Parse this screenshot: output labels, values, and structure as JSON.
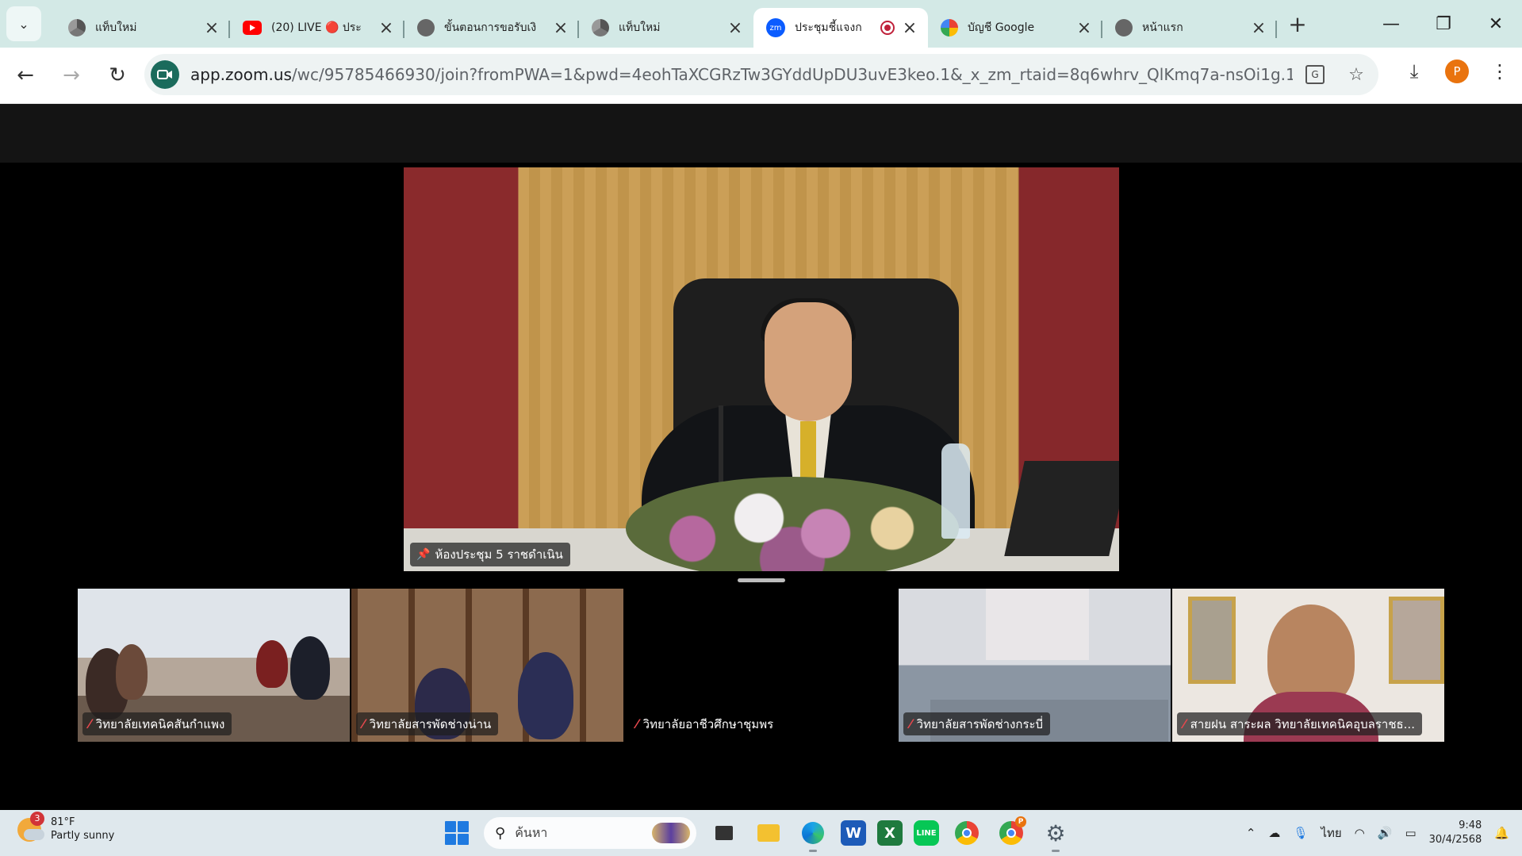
{
  "browser": {
    "tabs": [
      {
        "label": "แท็บใหม่",
        "icon": "chrome-icon",
        "active": false
      },
      {
        "label": "(20) LIVE 🔴 ประ",
        "icon": "youtube-icon",
        "active": false
      },
      {
        "label": "ขั้นตอนการขอรับเงิ",
        "icon": "globe-icon",
        "active": false
      },
      {
        "label": "แท็บใหม่",
        "icon": "chrome-icon",
        "active": false
      },
      {
        "label": "ประชุมชี้แจงก",
        "icon": "zoom-icon",
        "active": true
      },
      {
        "label": "บัญชี Google",
        "icon": "google-icon",
        "active": false
      },
      {
        "label": "หน้าแรก",
        "icon": "globe-icon",
        "active": false
      }
    ],
    "url_host": "app.zoom.us",
    "url_path": "/wc/95785466930/join?fromPWA=1&pwd=4eohTaXCGRzTw3GYddUpDU3uvE3keo.1&_x_zm_rtaid=8q6whrv_QlKmq7a-nsOi1g.174597...",
    "profile_initial": "P"
  },
  "meeting": {
    "speaker_name": "ห้องประชุม 5 ราชดำเนิน",
    "participants": [
      {
        "name": "วิทยาลัยเทคนิคสันกำแพง",
        "muted": true
      },
      {
        "name": "วิทยาลัยสารพัดช่างน่าน",
        "muted": true
      },
      {
        "name": "วิทยาลัยอาชีวศึกษาชุมพร",
        "muted": true
      },
      {
        "name": "วิทยาลัยสารพัดช่างกระบี่",
        "muted": true
      },
      {
        "name": "สายฝน สาระผล วิทยาลัยเทคนิคอุบลราชธ...",
        "muted": true
      }
    ]
  },
  "taskbar": {
    "weather_temp": "81°F",
    "weather_desc": "Partly sunny",
    "weather_badge": "3",
    "search_placeholder": "ค้นหา",
    "language": "ไทย",
    "time": "9:48",
    "date": "30/4/2568",
    "chrome_badge": "P"
  },
  "colors": {
    "tabstrip_bg": "#d3e9e6",
    "zoom_blue": "#0b5cff",
    "muted_red": "#e5484d",
    "accent_avatar": "#e9730e"
  }
}
